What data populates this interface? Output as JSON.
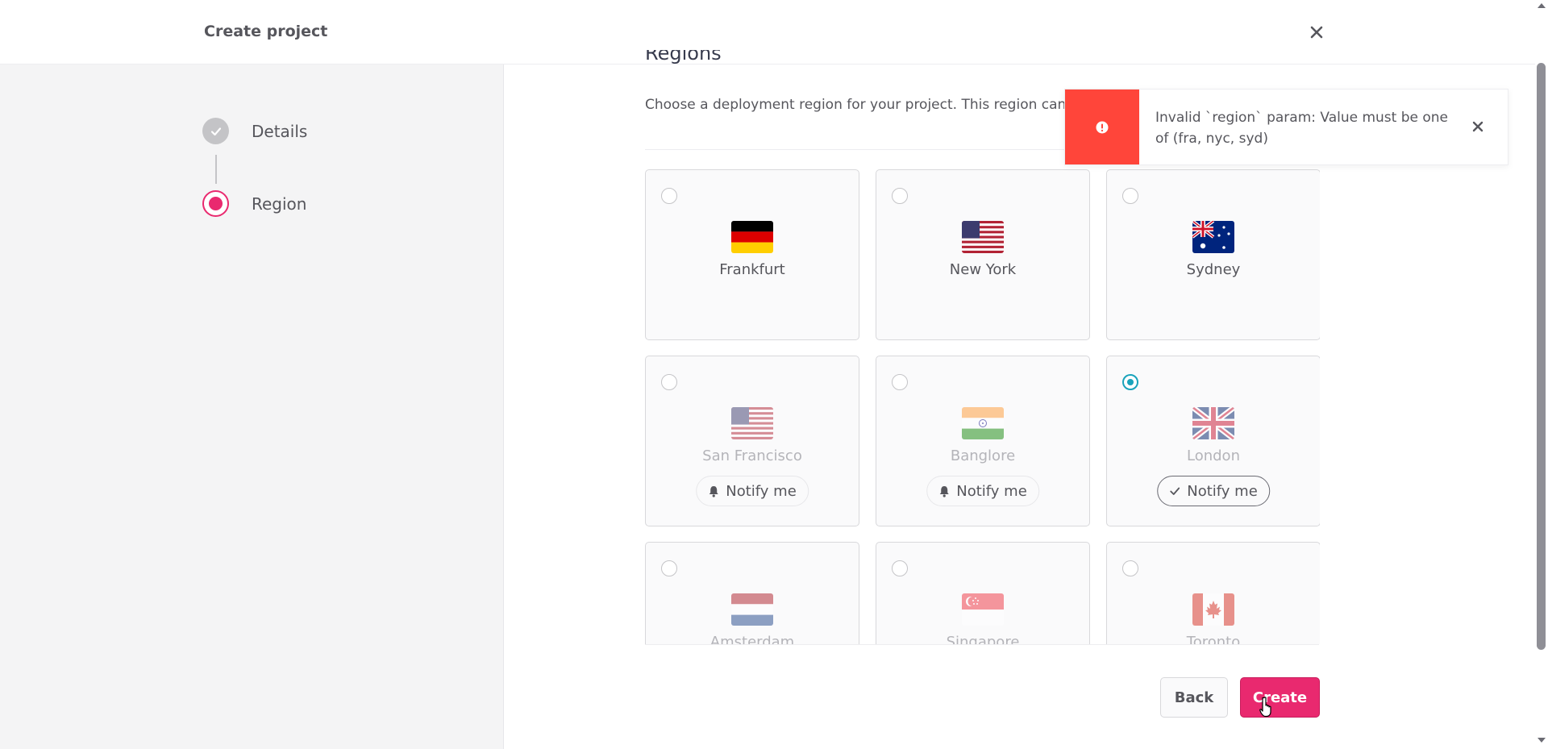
{
  "header": {
    "title": "Create project",
    "close_icon": "close-icon"
  },
  "steps": [
    {
      "label": "Details",
      "state": "done"
    },
    {
      "label": "Region",
      "state": "current"
    }
  ],
  "section": {
    "title": "Regions",
    "description": "Choose a deployment region for your project. This region cannot be changed."
  },
  "regions": [
    {
      "city": "Frankfurt",
      "flag": "de",
      "selected": false,
      "available": true
    },
    {
      "city": "New York",
      "flag": "us",
      "selected": false,
      "available": true
    },
    {
      "city": "Sydney",
      "flag": "au",
      "selected": false,
      "available": true
    },
    {
      "city": "San Francisco",
      "flag": "us",
      "selected": false,
      "available": false,
      "notify_label": "Notify me",
      "notify_icon": "bell-icon",
      "notified": false
    },
    {
      "city": "Banglore",
      "flag": "in",
      "selected": false,
      "available": false,
      "notify_label": "Notify me",
      "notify_icon": "bell-icon",
      "notified": false
    },
    {
      "city": "London",
      "flag": "gb",
      "selected": true,
      "available": false,
      "notify_label": "Notify me",
      "notify_icon": "check-icon",
      "notified": true
    },
    {
      "city": "Amsterdam",
      "flag": "nl",
      "selected": false,
      "available": false
    },
    {
      "city": "Singapore",
      "flag": "sg",
      "selected": false,
      "available": false
    },
    {
      "city": "Toronto",
      "flag": "ca",
      "selected": false,
      "available": false
    }
  ],
  "buttons": {
    "back": "Back",
    "create": "Create"
  },
  "toast": {
    "type": "error",
    "message": "Invalid `region` param: Value must be one of (fra, nyc, syd)",
    "icon": "exclamation-icon",
    "close_icon": "close-icon"
  },
  "colors": {
    "accent": "#e9296f",
    "selected": "#19a3bb",
    "error": "#ff453a"
  }
}
